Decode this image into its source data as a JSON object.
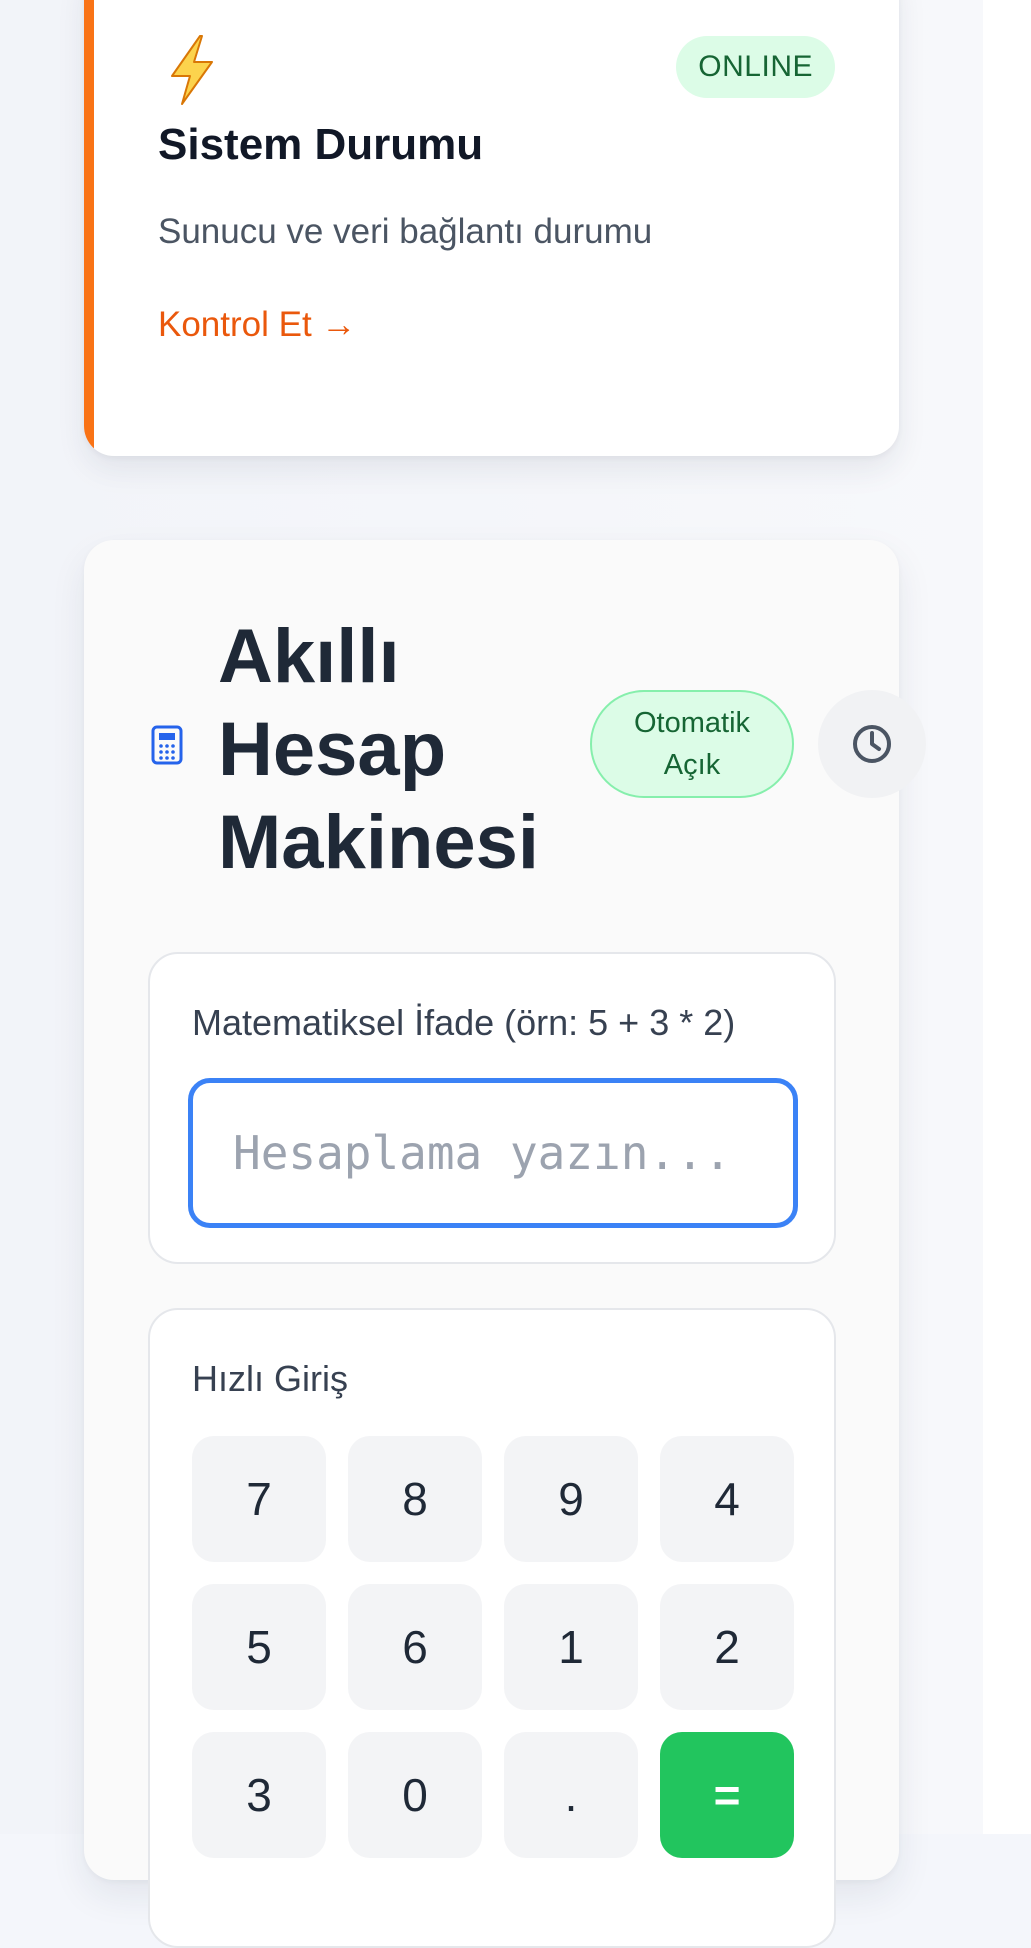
{
  "status_card": {
    "badge": "ONLINE",
    "title": "Sistem Durumu",
    "description": "Sunucu ve veri bağlantı durumu",
    "link": "Kontrol Et →",
    "accent_color": "#f97316",
    "icon": "lightning-bolt-icon"
  },
  "calculator": {
    "title": "Akıllı Hesap Makinesi",
    "icon": "calculator-icon",
    "auto_badge": "Otomatik Açık",
    "history_icon": "clock-icon",
    "input": {
      "label": "Matematiksel İfade (örn: 5 + 3 * 2)",
      "placeholder": "Hesaplama yazın...",
      "value": ""
    },
    "quick_entry": {
      "label": "Hızlı Giriş",
      "keys": [
        "7",
        "8",
        "9",
        "4",
        "5",
        "6",
        "1",
        "2",
        "3",
        "0",
        ".",
        "="
      ]
    },
    "colors": {
      "input_border": "#3b82f6",
      "equals_key": "#22c55e",
      "badge_bg": "#dcfce7",
      "badge_text": "#166534"
    }
  }
}
